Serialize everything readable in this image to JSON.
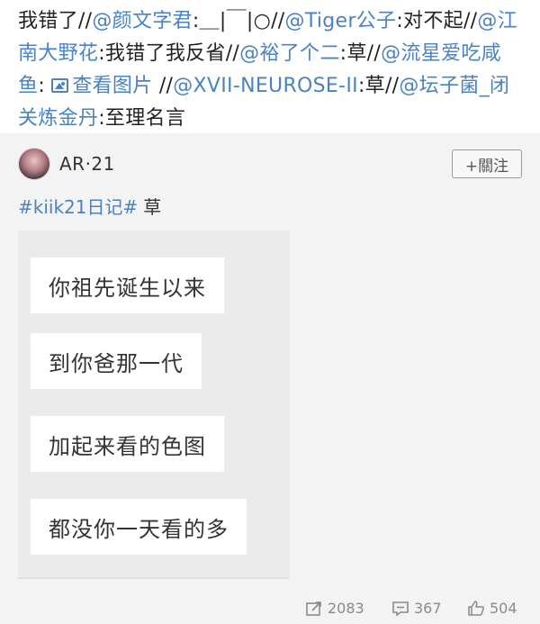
{
  "repost_chain": [
    {
      "type": "text",
      "text": "我错了//"
    },
    {
      "type": "mention",
      "text": "@颜文字君"
    },
    {
      "type": "text",
      "text": ":＿|￣|○//"
    },
    {
      "type": "mention",
      "text": "@Tiger公子"
    },
    {
      "type": "text",
      "text": ":对不起//"
    },
    {
      "type": "mention",
      "text": "@江南大野花"
    },
    {
      "type": "text",
      "text": ":我错了我反省//"
    },
    {
      "type": "mention",
      "text": "@裕了个二"
    },
    {
      "type": "text",
      "text": ":草//"
    },
    {
      "type": "mention",
      "text": "@流星爱吃咸鱼"
    },
    {
      "type": "text",
      "text": ": "
    },
    {
      "type": "link",
      "text": "查看图片"
    },
    {
      "type": "text",
      "text": " //"
    },
    {
      "type": "mention",
      "text": "@XVII-NEUROSE-II"
    },
    {
      "type": "text",
      "text": ":草//"
    },
    {
      "type": "mention",
      "text": "@坛子菌_闭关炼金丹"
    },
    {
      "type": "text",
      "text": ":至理名言"
    }
  ],
  "original_post": {
    "author": "AR·21",
    "follow_label": "+關注",
    "hashtag": "#kiik21日记#",
    "text": "草",
    "chat_bubbles": [
      "你祖先诞生以来",
      "到你爸那一代",
      "加起来看的色图",
      "都没你一天看的多"
    ]
  },
  "actions": {
    "repost_count": "2083",
    "comment_count": "367",
    "like_count": "504",
    "icons": [
      "repost-icon",
      "comment-icon",
      "like-icon"
    ]
  },
  "colors": {
    "link": "#4a82c3",
    "card_bg": "#f3f3f3",
    "text": "#222222",
    "muted": "#8a8a8a"
  }
}
